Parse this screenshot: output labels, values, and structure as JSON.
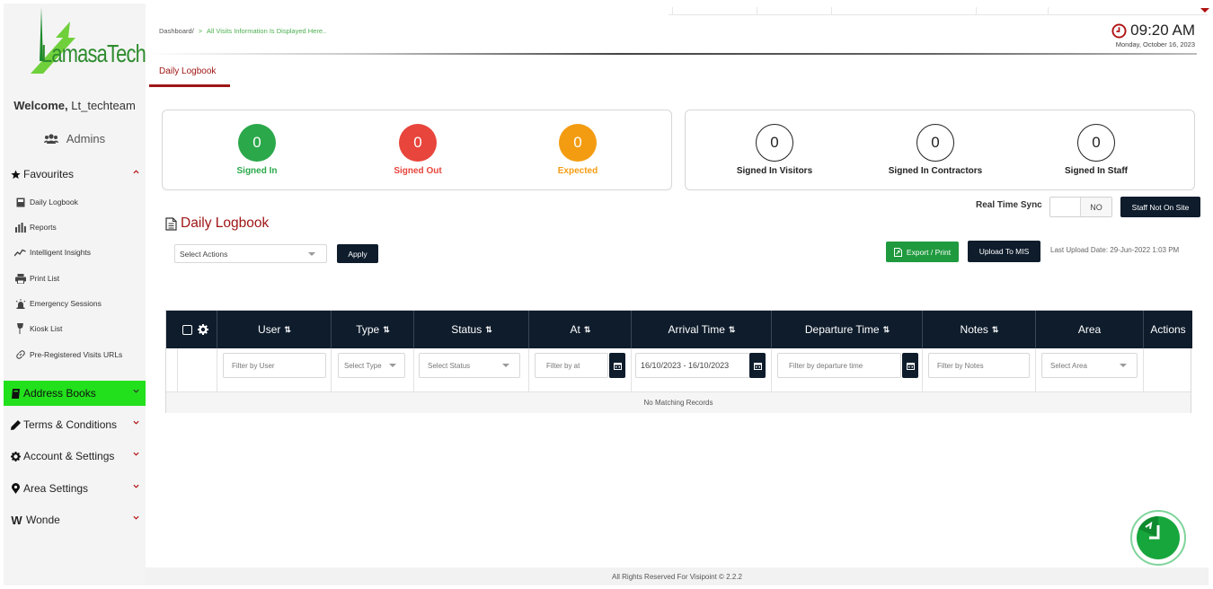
{
  "sidebar": {
    "logo_text": "LamasaTech",
    "welcome_prefix": "Welcome,",
    "welcome_user": "Lt_techteam",
    "role": "Admins",
    "favourites_label": "Favourites",
    "favourites_items": [
      {
        "label": "Daily Logbook",
        "icon": "book-icon"
      },
      {
        "label": "Reports",
        "icon": "bar-chart-icon"
      },
      {
        "label": "Intelligent Insights",
        "icon": "line-chart-icon"
      },
      {
        "label": "Print List",
        "icon": "printer-icon"
      },
      {
        "label": "Emergency Sessions",
        "icon": "alarm-icon"
      },
      {
        "label": "Kiosk List",
        "icon": "kiosk-icon"
      },
      {
        "label": "Pre-Registered Visits URLs",
        "icon": "link-icon"
      }
    ],
    "groups": [
      {
        "label": "Address Books",
        "icon": "book-icon",
        "active": true
      },
      {
        "label": "Terms & Conditions",
        "icon": "pencil-icon"
      },
      {
        "label": "Account & Settings",
        "icon": "gear-icon"
      },
      {
        "label": "Area Settings",
        "icon": "map-marker-icon"
      },
      {
        "label": "Wonde",
        "icon": "wonde-w-icon"
      }
    ]
  },
  "header": {
    "breadcrumb_root": "Dashboard/",
    "breadcrumb_sep": ">",
    "breadcrumb_current": "All Visits Information Is Displayed Here..",
    "time": "09:20 AM",
    "date": "Monday, October 16, 2023"
  },
  "tabs": [
    {
      "label": "Daily Logbook",
      "active": true
    }
  ],
  "stats_left": [
    {
      "value": "0",
      "label": "Signed In",
      "color": "#2aa84a"
    },
    {
      "value": "0",
      "label": "Signed Out",
      "color": "#e8453c"
    },
    {
      "value": "0",
      "label": "Expected",
      "color": "#f39c12"
    }
  ],
  "stats_right": [
    {
      "value": "0",
      "label": "Signed In Visitors"
    },
    {
      "value": "0",
      "label": "Signed In Contractors"
    },
    {
      "value": "0",
      "label": "Signed In Staff"
    }
  ],
  "logbook": {
    "title": "Daily Logbook",
    "real_time_sync_label": "Real Time Sync",
    "toggle_value": "NO",
    "staff_not_on_site_label": "Staff Not On Site",
    "select_actions_placeholder": "Select Actions",
    "apply_label": "Apply",
    "export_label": "Export / Print",
    "upload_label": "Upload To MIS",
    "last_upload": "Last Upload Date: 29-Jun-2022 1:03 PM"
  },
  "table": {
    "columns": [
      "User",
      "Type",
      "Status",
      "At",
      "Arrival Time",
      "Departure Time",
      "Notes",
      "Area",
      "Actions"
    ],
    "sort_glyph": "⇅",
    "filters": {
      "user": "Filter by User",
      "type": "Select Type",
      "status": "Select Status",
      "at": "Filter by at",
      "arrival": "16/10/2023 - 16/10/2023",
      "departure": "Filter by departure time",
      "notes": "Filter by Notes",
      "area": "Select Area"
    },
    "empty_message": "No Matching Records"
  },
  "footer": {
    "text": "All Rights Reserved For Visipoint © 2.2.2"
  },
  "colors": {
    "accent_red": "#a01616",
    "navy": "#0e1c2c",
    "active_green": "#22e01c"
  }
}
